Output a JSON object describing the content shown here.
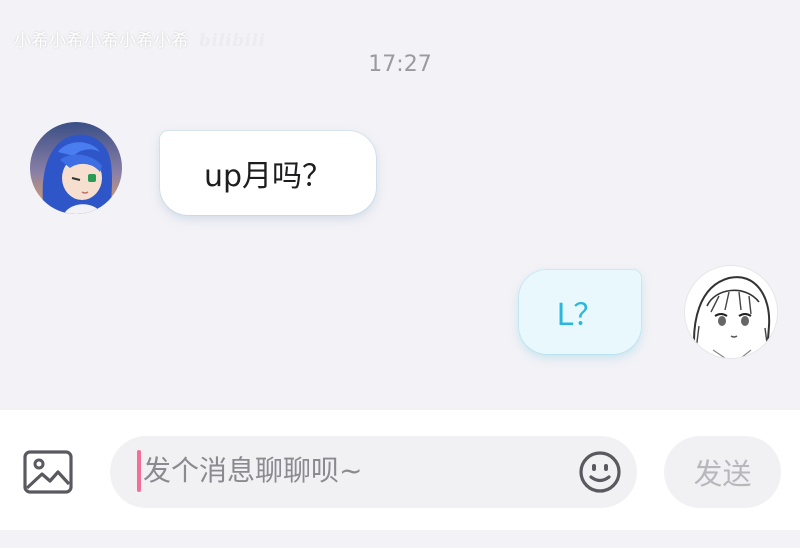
{
  "watermark": {
    "text": "小希小希小希小希小希",
    "brand": "bilibili"
  },
  "chat": {
    "timestamp": "17:27",
    "messages": [
      {
        "side": "received",
        "text": "up月吗？",
        "avatar_icon": "anime-girl-blue-hair-avatar"
      },
      {
        "side": "sent",
        "text": "L？",
        "avatar_icon": "anime-girl-sketch-avatar"
      }
    ]
  },
  "composer": {
    "image_icon": "image-icon",
    "placeholder": "发个消息聊聊呗~",
    "emoji_icon": "emoji-icon",
    "send_label": "发送"
  },
  "colors": {
    "background": "#f3f2f6",
    "sent_text": "#29b7de",
    "sent_bubble": "#e9f8fc",
    "caret": "#f36f97"
  }
}
